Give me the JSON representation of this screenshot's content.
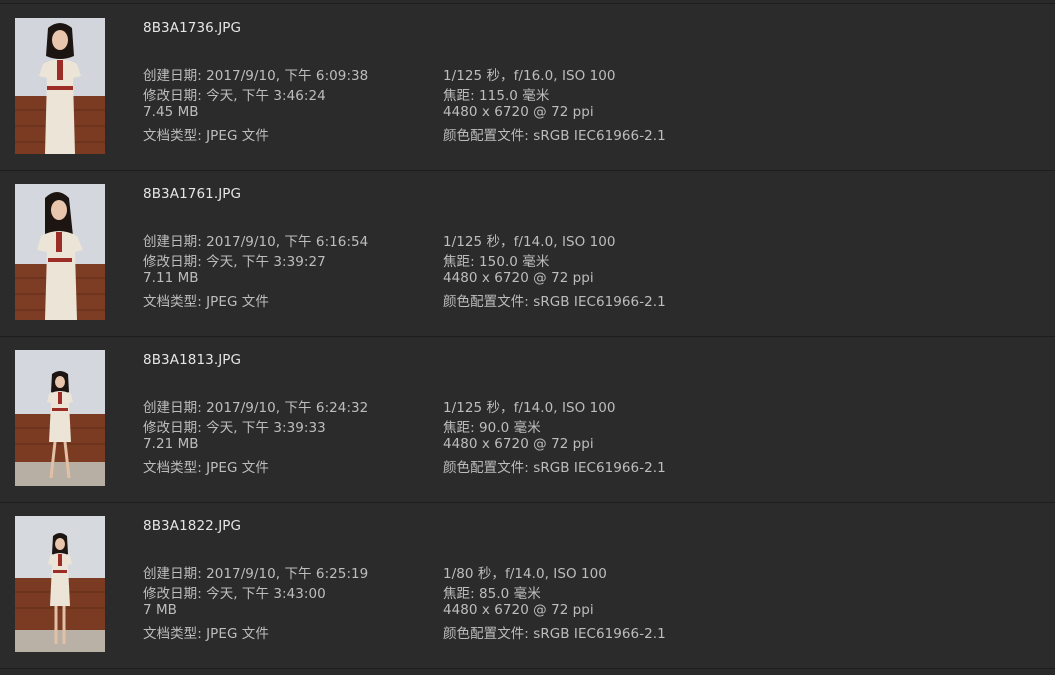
{
  "files": [
    {
      "name": "8B3A1736.JPG",
      "created": "创建日期: 2017/9/10, 下午 6:09:38",
      "modified": "修改日期: 今天, 下午 3:46:24",
      "size": "7.45 MB",
      "type": "文档类型: JPEG 文件",
      "exposure": "1/125 秒，f/16.0, ISO 100",
      "focal": "焦距: 115.0 毫米",
      "dimensions": "4480 x 6720 @ 72 ppi",
      "profile": "颜色配置文件: sRGB IEC61966-2.1"
    },
    {
      "name": "8B3A1761.JPG",
      "created": "创建日期: 2017/9/10, 下午 6:16:54",
      "modified": "修改日期: 今天, 下午 3:39:27",
      "size": "7.11 MB",
      "type": "文档类型: JPEG 文件",
      "exposure": "1/125 秒，f/14.0, ISO 100",
      "focal": "焦距: 150.0 毫米",
      "dimensions": "4480 x 6720 @ 72 ppi",
      "profile": "颜色配置文件: sRGB IEC61966-2.1"
    },
    {
      "name": "8B3A1813.JPG",
      "created": "创建日期: 2017/9/10, 下午 6:24:32",
      "modified": "修改日期: 今天, 下午 3:39:33",
      "size": "7.21 MB",
      "type": "文档类型: JPEG 文件",
      "exposure": "1/125 秒，f/14.0, ISO 100",
      "focal": "焦距: 90.0 毫米",
      "dimensions": "4480 x 6720 @ 72 ppi",
      "profile": "颜色配置文件: sRGB IEC61966-2.1"
    },
    {
      "name": "8B3A1822.JPG",
      "created": "创建日期: 2017/9/10, 下午 6:25:19",
      "modified": "修改日期: 今天, 下午 3:43:00",
      "size": "7 MB",
      "type": "文档类型: JPEG 文件",
      "exposure": "1/80 秒，f/14.0, ISO 100",
      "focal": "焦距: 85.0 毫米",
      "dimensions": "4480 x 6720 @ 72 ppi",
      "profile": "颜色配置文件: sRGB IEC61966-2.1"
    }
  ],
  "colors": {
    "background": "#2b2b2b",
    "divider": "#1d1d1d",
    "filename_text": "#e6e6e6",
    "meta_text": "#bdbdbd"
  }
}
